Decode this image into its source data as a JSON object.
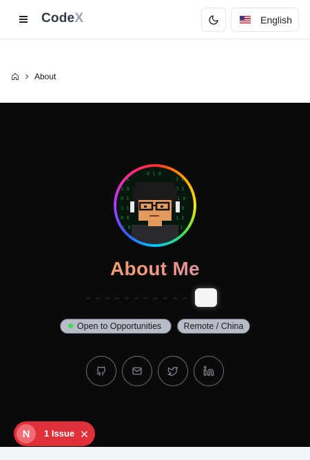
{
  "header": {
    "brand_main": "Code",
    "brand_accent": "X",
    "language_label": "English"
  },
  "breadcrumb": {
    "current": "About"
  },
  "about": {
    "title": "About Me",
    "badges": [
      {
        "label": "Open to Opportunities",
        "status_color": "#3ddc54"
      },
      {
        "label": "Remote / China"
      }
    ],
    "socials": [
      "github-icon",
      "mail-icon",
      "twitter-icon",
      "linkedin-icon"
    ]
  },
  "dev_overlay": {
    "badge_letter": "N",
    "issue_label": "1 Issue"
  },
  "colors": {
    "dark_bg": "#0b0a0b",
    "title_gradient_start": "#f4a65a",
    "title_gradient_end": "#c87ed8",
    "issue_red": "#e0313b"
  }
}
